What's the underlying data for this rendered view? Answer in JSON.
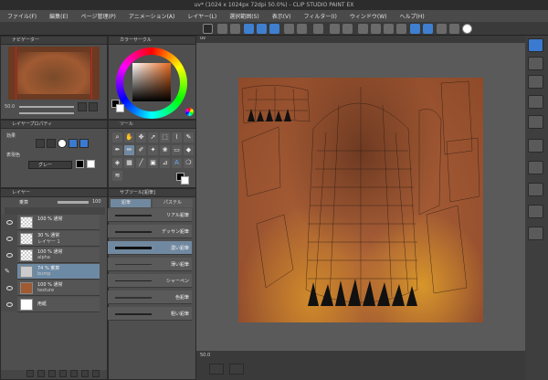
{
  "window": {
    "title": "uv* (1024 x 1024px 72dpi 50.0%) - CLIP STUDIO PAINT EX"
  },
  "menu": [
    "ファイル(F)",
    "編集(E)",
    "ページ管理(P)",
    "アニメーション(A)",
    "レイヤー(L)",
    "選択範囲(S)",
    "表示(V)",
    "フィルター(I)",
    "ウィンドウ(W)",
    "ヘルプ(H)"
  ],
  "navigator": {
    "title": "ナビゲーター",
    "zoom": "50.0"
  },
  "color_panel": {
    "title": "カラーサークル",
    "accent_hue": "#e86a1e"
  },
  "layer_property": {
    "title": "レイヤープロパティ",
    "effect_label": "効果",
    "color_label": "表現色",
    "color_value": "グレー"
  },
  "tool_panel": {
    "title": "ツール"
  },
  "layers": {
    "title": "レイヤー",
    "blend_mode": "乗算",
    "opacity": "100",
    "items": [
      {
        "opacity": "100 %",
        "mode": "通常",
        "name": ""
      },
      {
        "opacity": "30 %",
        "mode": "通常",
        "name": "レイヤー 1"
      },
      {
        "opacity": "100 %",
        "mode": "通常",
        "name": "alpha"
      },
      {
        "opacity": "74 %",
        "mode": "乗算",
        "name": "bump"
      },
      {
        "opacity": "100 %",
        "mode": "通常",
        "name": "texture"
      },
      {
        "opacity": "",
        "mode": "",
        "name": "用紙"
      }
    ]
  },
  "subtool": {
    "title": "サブツール[鉛筆]",
    "tabs": [
      "鉛筆",
      "パステル"
    ],
    "brushes": [
      "リアル鉛筆",
      "デッサン鉛筆",
      "濃い鉛筆",
      "薄い鉛筆",
      "シャーペン",
      "色鉛筆",
      "粗い鉛筆"
    ]
  },
  "canvas": {
    "tab": "uv",
    "zoom": "50.0",
    "bg_color": "#5a5a5a"
  }
}
